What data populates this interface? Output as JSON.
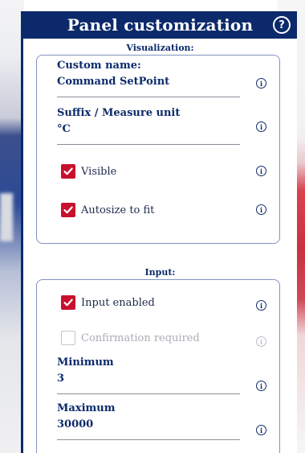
{
  "panel": {
    "title": "Panel customization",
    "help_glyph": "?"
  },
  "visualization": {
    "section_title": "Visualization:",
    "custom_name": {
      "label": "Custom name:",
      "value": "Command SetPoint"
    },
    "suffix": {
      "label": "Suffix / Measure unit",
      "value": "°C"
    },
    "visible": {
      "label": "Visible",
      "checked": true
    },
    "autosize": {
      "label": "Autosize to fit",
      "checked": true
    }
  },
  "input": {
    "section_title": "Input:",
    "input_enabled": {
      "label": "Input enabled",
      "checked": true
    },
    "confirmation": {
      "label": "Confirmation required",
      "checked": false,
      "disabled": true
    },
    "minimum": {
      "label": "Minimum",
      "value": "3"
    },
    "maximum": {
      "label": "Maximum",
      "value": "30000"
    }
  },
  "icons": {
    "info_glyph": "i",
    "checkmark": "checkmark-icon",
    "accent_color": "#c8102e",
    "brand_color": "#0c2a6b"
  }
}
